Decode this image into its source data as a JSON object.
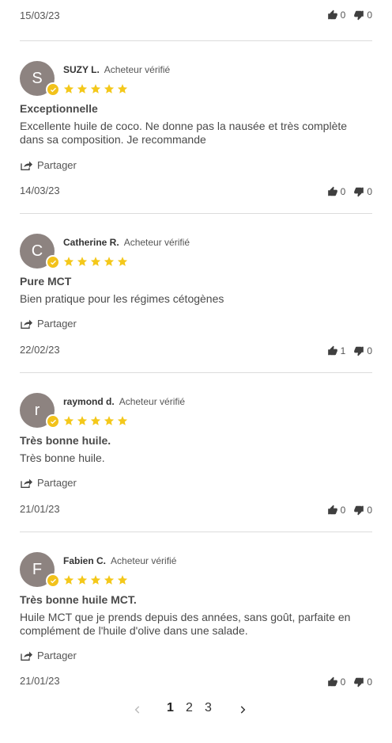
{
  "first_review_footer": {
    "date": "15/03/23",
    "up": "0",
    "down": "0"
  },
  "reviews": [
    {
      "initial": "S",
      "author": "SUZY L.",
      "verified": "Acheteur vérifié",
      "title": "Exceptionnelle",
      "body": "Excellente huile de coco. Ne donne pas la nausée et très complète dans sa composition. Je recommande",
      "share": "Partager",
      "date": "14/03/23",
      "up": "0",
      "down": "0"
    },
    {
      "initial": "C",
      "author": "Catherine R.",
      "verified": "Acheteur vérifié",
      "title": "Pure MCT",
      "body": "Bien pratique pour les régimes cétogènes",
      "share": "Partager",
      "date": "22/02/23",
      "up": "1",
      "down": "0"
    },
    {
      "initial": "r",
      "author": "raymond d.",
      "verified": "Acheteur vérifié",
      "title": "Très bonne huile.",
      "body": "Très bonne huile.",
      "share": "Partager",
      "date": "21/01/23",
      "up": "0",
      "down": "0"
    },
    {
      "initial": "F",
      "author": "Fabien C.",
      "verified": "Acheteur vérifié",
      "title": "Très bonne huile MCT.",
      "body": "Huile MCT que je prends depuis des années, sans goût, parfaite en complément de l'huile d'olive dans une salade.",
      "share": "Partager",
      "date": "21/01/23",
      "up": "0",
      "down": "0"
    }
  ],
  "pagination": {
    "pages": [
      "1",
      "2",
      "3"
    ],
    "current": "1"
  },
  "colors": {
    "star": "#f4c81a",
    "avatar": "#8d8380",
    "badge": "#f2c21b"
  }
}
